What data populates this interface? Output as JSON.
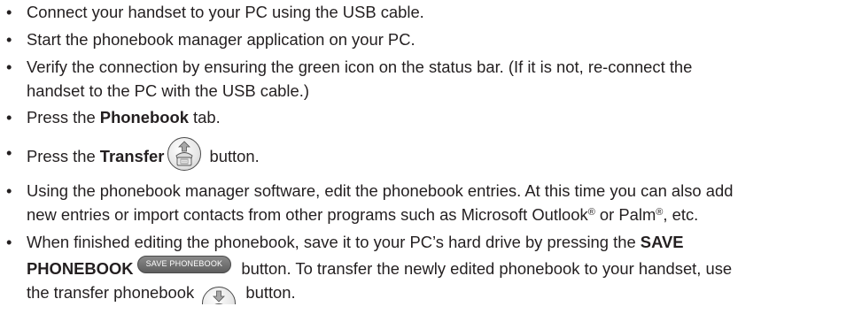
{
  "bullet": "•",
  "steps": [
    {
      "text": "Connect your handset to your PC using the USB cable."
    },
    {
      "text": "Start the phonebook manager application on your PC."
    },
    {
      "line1": "Verify the connection by ensuring the green icon on the status bar. (If it is not, re-connect the",
      "line2": "handset to the PC with the USB cable.)"
    },
    {
      "pre": "Press the ",
      "bold": "Phonebook",
      "post": " tab."
    },
    {
      "pre": "Press the ",
      "bold": "Transfer",
      "post": " button."
    },
    {
      "line1": "Using the phonebook manager software, edit the phonebook entries. At this time you can also add",
      "line2a": "new entries or import contacts from other programs such as Microsoft Outlook",
      "reg": "®",
      "line2b": " or Palm",
      "line2c": ", etc."
    },
    {
      "line1a": "When finished editing the phonebook, save it to your PC’s hard drive by pressing the ",
      "line1bold": "SAVE",
      "line2bold": "PHONEBOOK",
      "line2post": " button. To transfer the newly edited phonebook to your handset, use",
      "line3pre": "the transfer phonebook ",
      "line3post": " button."
    }
  ],
  "buttons": {
    "save_phonebook_label": "SAVE PHONEBOOK"
  },
  "icons": {
    "transfer": "phone-upload-icon",
    "transfer_phonebook": "phone-download-icon"
  }
}
